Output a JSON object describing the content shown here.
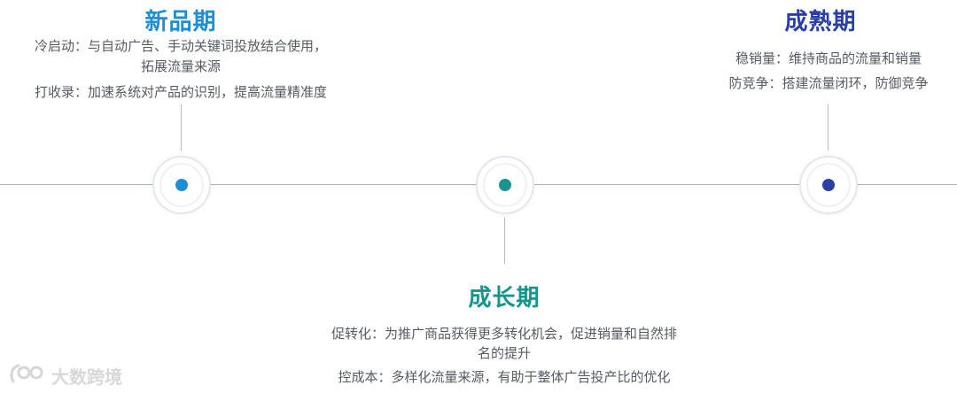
{
  "colors": {
    "new_stage": "#1c8fd6",
    "growth_stage": "#15958c",
    "mature_stage": "#2a3ea8"
  },
  "stages": [
    {
      "title": "新品期",
      "lines": [
        "冷启动：与自动广告、手动关键词投放结合使用，",
        "拓展流量来源",
        "打收录：加速系统对产品的识别，提高流量精准度"
      ]
    },
    {
      "title": "成长期",
      "lines": [
        "促转化：为推广商品获得更多转化机会，促进销量和自然排",
        "名的提升",
        "控成本：多样化流量来源，有助于整体广告投产比的优化"
      ]
    },
    {
      "title": "成熟期",
      "lines": [
        "稳销量：维持商品的流量和销量",
        "防竞争：搭建流量闭环，防御竞争"
      ]
    }
  ],
  "watermark": {
    "icon": "brand-logo-icon",
    "text": "大数跨境"
  }
}
